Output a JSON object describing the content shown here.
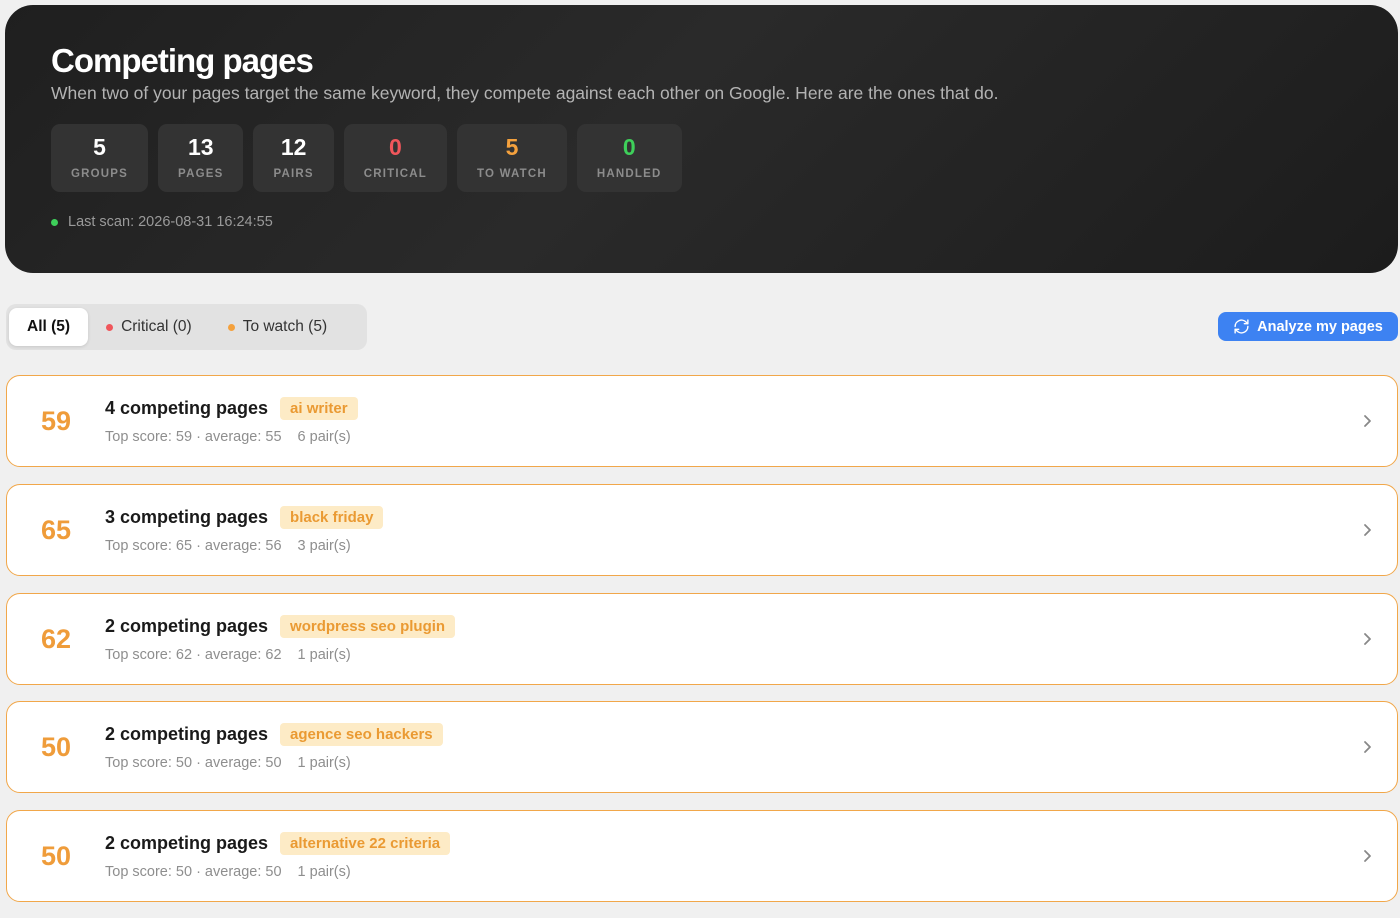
{
  "header": {
    "title": "Competing pages",
    "subtitle": "When two of your pages target the same keyword, they compete against each other on Google. Here are the ones that do.",
    "stats": [
      {
        "value": "5",
        "label": "GROUPS",
        "color": "#ffffff"
      },
      {
        "value": "13",
        "label": "PAGES",
        "color": "#ffffff"
      },
      {
        "value": "12",
        "label": "PAIRS",
        "color": "#ffffff"
      },
      {
        "value": "0",
        "label": "CRITICAL",
        "color": "#f0565b"
      },
      {
        "value": "5",
        "label": "TO WATCH",
        "color": "#f4a13d"
      },
      {
        "value": "0",
        "label": "HANDLED",
        "color": "#3ecf5a"
      }
    ],
    "last_scan": "Last scan: 2026-08-31 16:24:55"
  },
  "filters": [
    {
      "label": "All (5)",
      "active": true,
      "dot_color": ""
    },
    {
      "label": "Critical (0)",
      "active": false,
      "dot_color": "#f0565b"
    },
    {
      "label": "To watch (5)",
      "active": false,
      "dot_color": "#f4a13d"
    }
  ],
  "analyze_button": {
    "label": "Analyze my pages",
    "icon": "refresh-icon"
  },
  "groups": [
    {
      "score": "59",
      "title": "4 competing pages",
      "keyword": "ai writer",
      "stats": "Top score: 59 · average: 55",
      "pairs": "6 pair(s)"
    },
    {
      "score": "65",
      "title": "3 competing pages",
      "keyword": "black friday",
      "stats": "Top score: 65 · average: 56",
      "pairs": "3 pair(s)"
    },
    {
      "score": "62",
      "title": "2 competing pages",
      "keyword": "wordpress seo plugin",
      "stats": "Top score: 62 · average: 62",
      "pairs": "1 pair(s)"
    },
    {
      "score": "50",
      "title": "2 competing pages",
      "keyword": "agence seo hackers",
      "stats": "Top score: 50 · average: 50",
      "pairs": "1 pair(s)"
    },
    {
      "score": "50",
      "title": "2 competing pages",
      "keyword": "alternative 22 criteria",
      "stats": "Top score: 50 · average: 50",
      "pairs": "1 pair(s)"
    }
  ]
}
